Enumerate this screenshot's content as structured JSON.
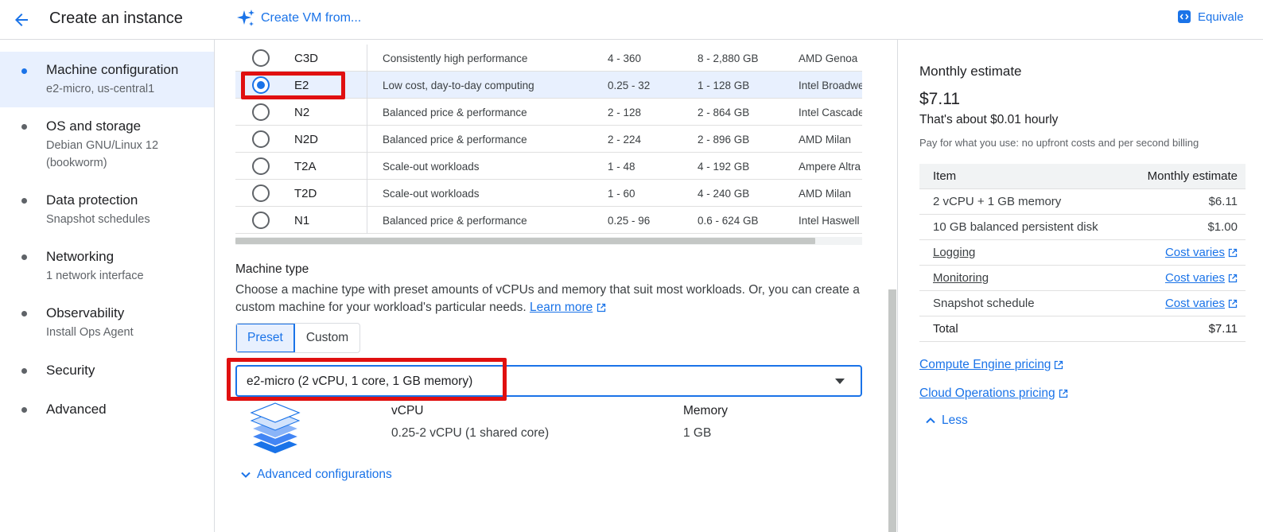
{
  "header": {
    "title": "Create an instance",
    "create_vm": "Create VM from...",
    "equivalent": "Equivale"
  },
  "nav": {
    "items": [
      {
        "title": "Machine configuration",
        "sub": "e2-micro, us-central1",
        "active": true
      },
      {
        "title": "OS and storage",
        "sub": "Debian GNU/Linux 12",
        "sub2": "(bookworm)"
      },
      {
        "title": "Data protection",
        "sub": "Snapshot schedules"
      },
      {
        "title": "Networking",
        "sub": "1 network interface"
      },
      {
        "title": "Observability",
        "sub": "Install Ops Agent"
      },
      {
        "title": "Security"
      },
      {
        "title": "Advanced"
      }
    ]
  },
  "families": [
    {
      "name": "C3D",
      "desc": "Consistently high performance",
      "vcpu": "4 - 360",
      "memory": "8 - 2,880 GB",
      "platform": "AMD Genoa",
      "selected": false
    },
    {
      "name": "E2",
      "desc": "Low cost, day-to-day computing",
      "vcpu": "0.25 - 32",
      "memory": "1 - 128 GB",
      "platform": "Intel Broadwe",
      "selected": true
    },
    {
      "name": "N2",
      "desc": "Balanced price & performance",
      "vcpu": "2 - 128",
      "memory": "2 - 864 GB",
      "platform": "Intel Cascade",
      "selected": false
    },
    {
      "name": "N2D",
      "desc": "Balanced price & performance",
      "vcpu": "2 - 224",
      "memory": "2 - 896 GB",
      "platform": "AMD Milan",
      "selected": false
    },
    {
      "name": "T2A",
      "desc": "Scale-out workloads",
      "vcpu": "1 - 48",
      "memory": "4 - 192 GB",
      "platform": "Ampere Altra",
      "selected": false
    },
    {
      "name": "T2D",
      "desc": "Scale-out workloads",
      "vcpu": "1 - 60",
      "memory": "4 - 240 GB",
      "platform": "AMD Milan",
      "selected": false
    },
    {
      "name": "N1",
      "desc": "Balanced price & performance",
      "vcpu": "0.25 - 96",
      "memory": "0.6 - 624 GB",
      "platform": "Intel Haswell",
      "selected": false
    }
  ],
  "machine_type": {
    "label": "Machine type",
    "description": "Choose a machine type with preset amounts of vCPUs and memory that suit most workloads. Or, you can create a custom machine for your workload's particular needs.",
    "learn_more": "Learn more",
    "tabs": [
      "Preset",
      "Custom"
    ],
    "selected_value": "e2-micro (2 vCPU, 1 core, 1 GB memory)",
    "vcpu_label": "vCPU",
    "vcpu_value": "0.25-2 vCPU (1 shared core)",
    "memory_label": "Memory",
    "memory_value": "1 GB",
    "advanced": "Advanced configurations"
  },
  "estimate": {
    "title": "Monthly estimate",
    "price": "$7.11",
    "hourly": "That's about $0.01 hourly",
    "note": "Pay for what you use: no upfront costs and per second billing",
    "col_item": "Item",
    "col_estimate": "Monthly estimate",
    "rows": [
      {
        "item": "2 vCPU + 1 GB memory",
        "cost": "$6.11",
        "item_link": false,
        "cost_link": false
      },
      {
        "item": "10 GB balanced persistent disk",
        "cost": "$1.00",
        "item_link": false,
        "cost_link": false
      },
      {
        "item": "Logging",
        "cost": "Cost varies",
        "item_link": true,
        "cost_link": true
      },
      {
        "item": "Monitoring",
        "cost": "Cost varies",
        "item_link": true,
        "cost_link": true
      },
      {
        "item": "Snapshot schedule",
        "cost": "Cost varies",
        "item_link": false,
        "cost_link": true
      }
    ],
    "total_label": "Total",
    "total_value": "$7.11",
    "links": [
      "Compute Engine pricing",
      "Cloud Operations pricing"
    ],
    "less": "Less"
  },
  "colors": {
    "accent": "#1a73e8",
    "annotation": "#e01010",
    "selected_bg": "#e8f0fe"
  }
}
